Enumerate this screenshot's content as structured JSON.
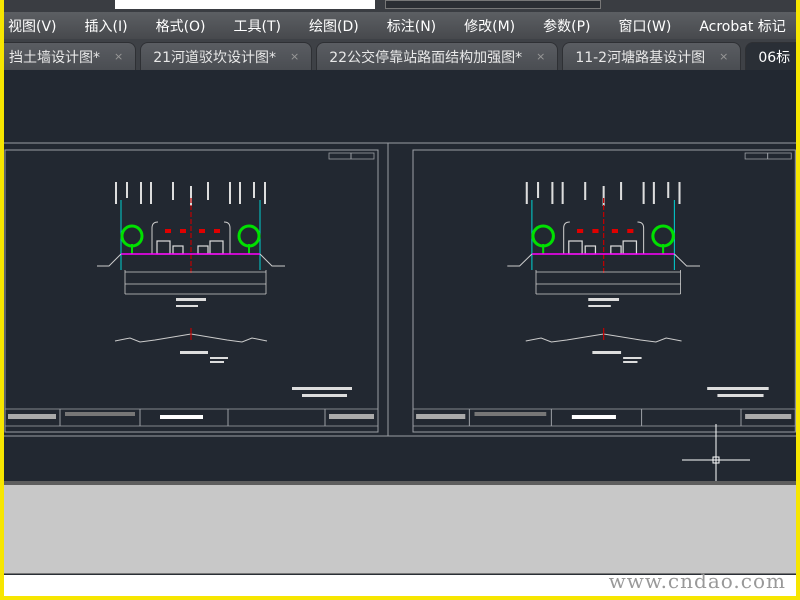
{
  "menu": [
    "视图(V)",
    "插入(I)",
    "格式(O)",
    "工具(T)",
    "绘图(D)",
    "标注(N)",
    "修改(M)",
    "参数(P)",
    "窗口(W)",
    "Acrobat 标记"
  ],
  "tabs": [
    {
      "label": "挡土墙设计图*",
      "close": "×"
    },
    {
      "label": "21河道驳坎设计图*",
      "close": "×"
    },
    {
      "label": "22公交停靠站路面结构加强图*",
      "close": "×"
    },
    {
      "label": "11-2河塘路基设计图",
      "close": "×"
    },
    {
      "label": "06标"
    }
  ],
  "watermark": "www.cndao.com",
  "colors": {
    "canvas": "#222831",
    "tree": "#00e000",
    "centerline": "#c00000",
    "accent": "#ff00ff",
    "cyan": "#00d0d0"
  }
}
